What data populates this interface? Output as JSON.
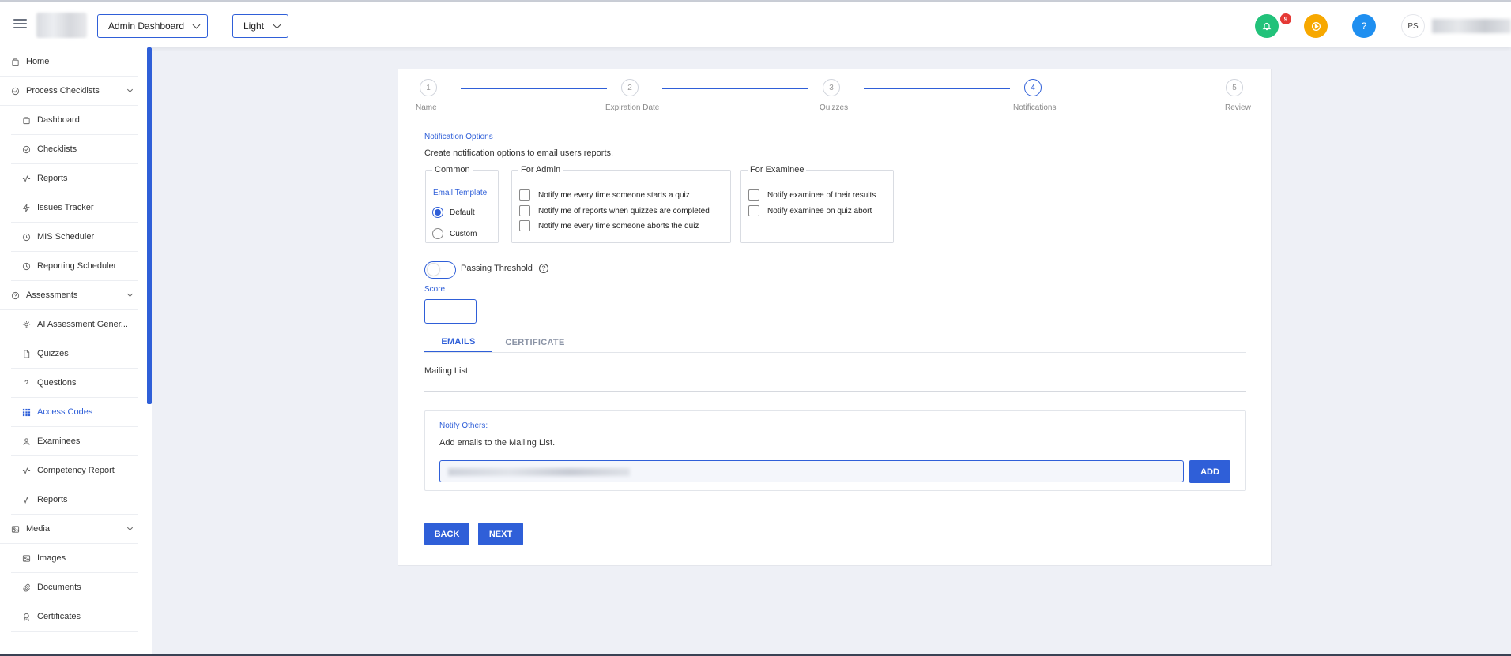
{
  "header": {
    "dashboard_select": "Admin Dashboard",
    "theme_select": "Light",
    "notification_count": "9",
    "help_label": "?",
    "avatar_initials": "PS"
  },
  "sidebar": {
    "items": [
      {
        "label": "Home",
        "icon": "home-icon"
      },
      {
        "label": "Process Checklists",
        "icon": "check-circle-icon"
      },
      {
        "label": "Dashboard",
        "icon": "dashboard-icon"
      },
      {
        "label": "Checklists",
        "icon": "check-circle-icon"
      },
      {
        "label": "Reports",
        "icon": "activity-icon"
      },
      {
        "label": "Issues Tracker",
        "icon": "bolt-icon"
      },
      {
        "label": "MIS Scheduler",
        "icon": "clock-icon"
      },
      {
        "label": "Reporting Scheduler",
        "icon": "clock-icon"
      },
      {
        "label": "Assessments",
        "icon": "question-circle-icon"
      },
      {
        "label": "AI Assessment Gener...",
        "icon": "bulb-icon"
      },
      {
        "label": "Quizzes",
        "icon": "document-icon"
      },
      {
        "label": "Questions",
        "icon": "question-icon"
      },
      {
        "label": "Access Codes",
        "icon": "grid-icon"
      },
      {
        "label": "Examinees",
        "icon": "user-icon"
      },
      {
        "label": "Competency Report",
        "icon": "activity-icon"
      },
      {
        "label": "Reports",
        "icon": "activity-icon"
      },
      {
        "label": "Media",
        "icon": "image-icon"
      },
      {
        "label": "Images",
        "icon": "image-icon"
      },
      {
        "label": "Documents",
        "icon": "paperclip-icon"
      },
      {
        "label": "Certificates",
        "icon": "award-icon"
      }
    ]
  },
  "stepper": {
    "steps": [
      {
        "num": "1",
        "label": "Name"
      },
      {
        "num": "2",
        "label": "Expiration Date"
      },
      {
        "num": "3",
        "label": "Quizzes"
      },
      {
        "num": "4",
        "label": "Notifications"
      },
      {
        "num": "5",
        "label": "Review"
      }
    ]
  },
  "notification_options": {
    "title": "Notification Options",
    "description": "Create notification options to email users reports.",
    "common": {
      "legend": "Common",
      "email_template_label": "Email Template",
      "options": [
        "Default",
        "Custom"
      ],
      "selected": "Default"
    },
    "for_admin": {
      "legend": "For Admin",
      "options": [
        "Notify me every time someone starts a quiz",
        "Notify me of reports when quizzes are completed",
        "Notify me every time someone aborts the quiz"
      ]
    },
    "for_examinee": {
      "legend": "For Examinee",
      "options": [
        "Notify examinee of their results",
        "Notify examinee on quiz abort"
      ]
    }
  },
  "passing_threshold": {
    "label": "Passing Threshold",
    "score_label": "Score",
    "score_value": ""
  },
  "tabs": [
    "EMAILS",
    "CERTIFICATE"
  ],
  "mailing": {
    "title": "Mailing List",
    "notify_title": "Notify Others:",
    "notify_desc": "Add emails to the Mailing List.",
    "add_label": "ADD"
  },
  "footer_buttons": {
    "back": "BACK",
    "next": "NEXT"
  },
  "colors": {
    "accent": "#2f5fd8",
    "bell_bg": "#22c27a",
    "play_bg": "#f7a800",
    "help_bg": "#1f8ff0"
  }
}
